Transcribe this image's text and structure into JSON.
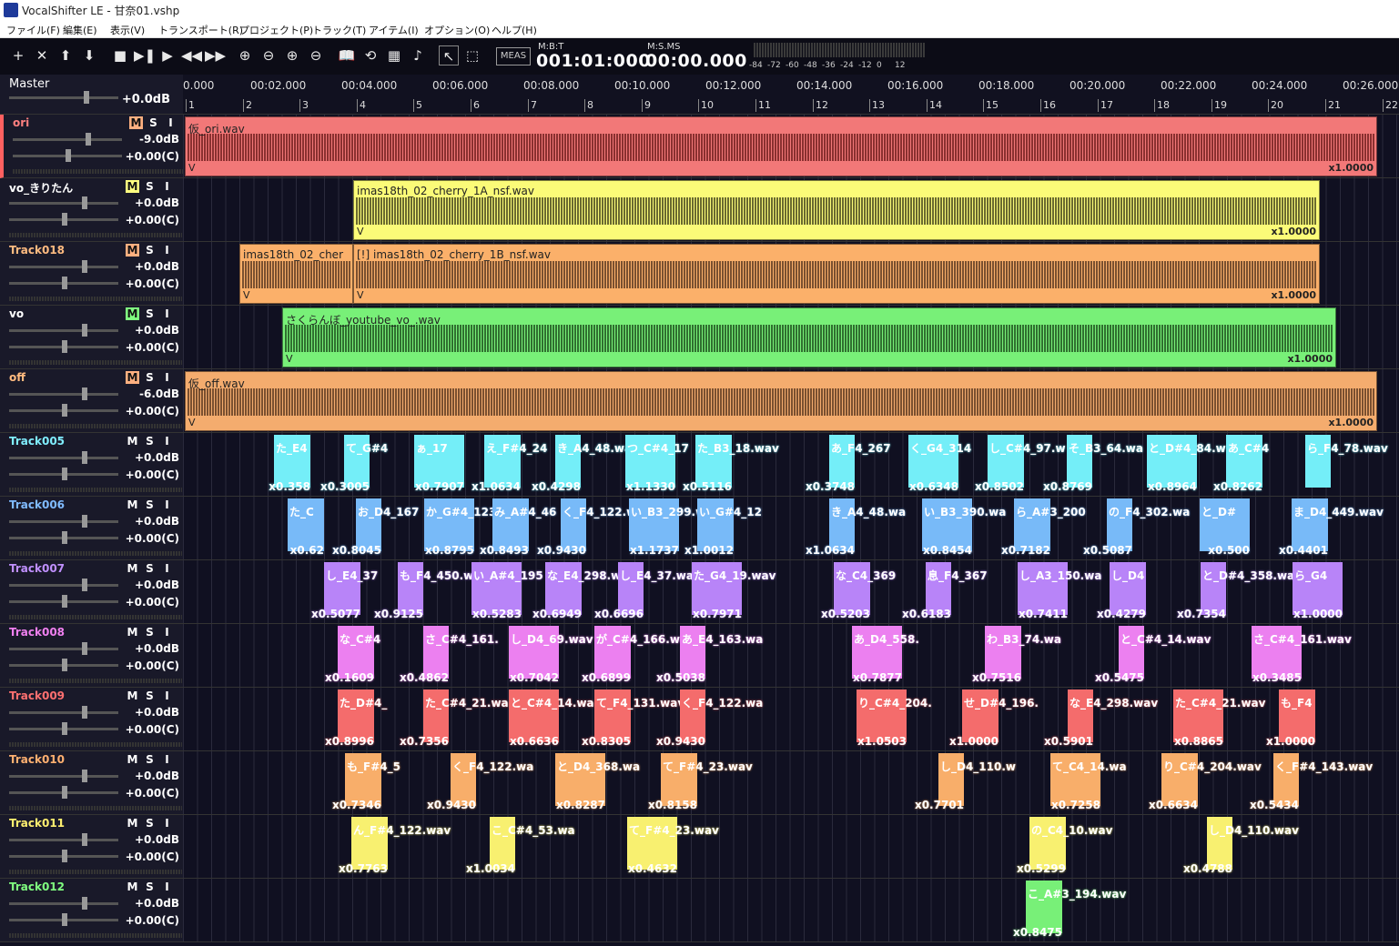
{
  "window": {
    "title": "VocalShifter LE - 甘奈01.vshp"
  },
  "menu": [
    "ファイル(F)",
    "編集(E)",
    "表示(V)",
    "トランスポート(R)",
    "プロジェクト(P)",
    "トラック(T)",
    "アイテム(I)",
    "オプション(O)",
    "ヘルプ(H)"
  ],
  "toolbar": {
    "icons": [
      "plus-icon",
      "close-icon",
      "arrow-up-icon",
      "arrow-down-icon",
      "stop-icon",
      "play-pause-icon",
      "play-icon",
      "rewind-icon",
      "fast-forward-icon",
      "zoom-in-h-icon",
      "zoom-out-h-icon",
      "zoom-in-v-icon",
      "zoom-out-v-icon",
      "book-icon",
      "loop-icon",
      "grid-icon",
      "note-icon",
      "pointer-icon",
      "select-rect-icon"
    ],
    "glyphs": [
      "+",
      "✕",
      "⬆",
      "⬇",
      "■",
      "▶❚",
      "▶",
      "◀◀",
      "▶▶",
      "⊕",
      "⊖",
      "⊕",
      "⊖",
      "📖",
      "⟲",
      "▦",
      "♪",
      "↖",
      "⬚"
    ],
    "meas_label": "MEAS",
    "mbt_label": "M:B:T",
    "mbt_value": "001:01:000",
    "msms_label": "M:S.MS",
    "msms_value": "00:00.000",
    "meter_ticks": [
      "-84",
      "-72",
      "-60",
      "-48",
      "-36",
      "-24",
      "-12",
      "0",
      "12"
    ]
  },
  "master": {
    "name": "Master",
    "volume": "+0.0dB"
  },
  "ruler": {
    "times": [
      "0.000",
      "00:02.000",
      "00:04.000",
      "00:06.000",
      "00:08.000",
      "00:10.000",
      "00:12.000",
      "00:14.000",
      "00:16.000",
      "00:18.000",
      "00:20.000",
      "00:22.000",
      "00:24.000",
      "00:26.000"
    ],
    "measures": [
      "1",
      "2",
      "3",
      "4",
      "5",
      "6",
      "7",
      "8",
      "9",
      "10",
      "11",
      "12",
      "13",
      "14",
      "15",
      "16",
      "17",
      "18",
      "19",
      "20",
      "21",
      "22"
    ]
  },
  "colors": {
    "ori": "#f27878",
    "vo_k": "#fbfb78",
    "t018": "#fbb06a",
    "vo": "#78f078",
    "off": "#f4ac6e",
    "t005": "#74eef8",
    "t006": "#78baf8",
    "t007": "#b884f8",
    "t008": "#ec80f0",
    "t009": "#f46c6c",
    "t010": "#f8ae6a",
    "t011": "#f8f070",
    "t012": "#78f078"
  },
  "tracks": [
    {
      "name": "ori",
      "volume": "-9.0dB",
      "pan": "+0.00(C)",
      "mute": true,
      "name_color": "#ff8080"
    },
    {
      "name": "vo_きりたん",
      "volume": "+0.0dB",
      "pan": "+0.00(C)",
      "mute": true,
      "name_color": "#ffffff"
    },
    {
      "name": "Track018",
      "volume": "+0.0dB",
      "pan": "+0.00(C)",
      "mute": true,
      "name_color": "#ffbb80"
    },
    {
      "name": "vo",
      "volume": "+0.0dB",
      "pan": "+0.00(C)",
      "mute": true,
      "name_color": "#ffffff"
    },
    {
      "name": "off",
      "volume": "-6.0dB",
      "pan": "+0.00(C)",
      "mute": true,
      "name_color": "#ffbb80"
    },
    {
      "name": "Track005",
      "volume": "+0.0dB",
      "pan": "+0.00(C)",
      "mute": false,
      "name_color": "#80eeff"
    },
    {
      "name": "Track006",
      "volume": "+0.0dB",
      "pan": "+0.00(C)",
      "mute": false,
      "name_color": "#80bbff"
    },
    {
      "name": "Track007",
      "volume": "+0.0dB",
      "pan": "+0.00(C)",
      "mute": false,
      "name_color": "#c090ff"
    },
    {
      "name": "Track008",
      "volume": "+0.0dB",
      "pan": "+0.00(C)",
      "mute": false,
      "name_color": "#f080f0"
    },
    {
      "name": "Track009",
      "volume": "+0.0dB",
      "pan": "+0.00(C)",
      "mute": false,
      "name_color": "#ff7070"
    },
    {
      "name": "Track010",
      "volume": "+0.0dB",
      "pan": "+0.00(C)",
      "mute": false,
      "name_color": "#ffb070"
    },
    {
      "name": "Track011",
      "volume": "+0.0dB",
      "pan": "+0.00(C)",
      "mute": false,
      "name_color": "#fff070"
    },
    {
      "name": "Track012",
      "volume": "+0.0dB",
      "pan": "+0.00(C)",
      "mute": false,
      "name_color": "#80ff80"
    }
  ],
  "msi": {
    "m": "M",
    "s": "S",
    "i": "I"
  },
  "lanes": [
    {
      "clips": [
        {
          "label": "仮_ori.wav",
          "v": "V",
          "scale": "x1.0000",
          "color": "ori",
          "wave": "#8a3030"
        }
      ]
    },
    {
      "clips": [
        {
          "label": "imas18th_02_cherry_1A_nsf.wav",
          "v": "V",
          "scale": "x1.0000",
          "color": "vo_k",
          "wave": "#6a6a30"
        }
      ]
    },
    {
      "clips": [
        {
          "label": "imas18th_02_cher",
          "v": "V",
          "scale": "",
          "color": "t018",
          "wave": "#7a5030"
        },
        {
          "label": "[!] imas18th_02_cherry_1B_nsf.wav",
          "v": "V",
          "scale": "x1.0000",
          "color": "t018",
          "wave": "#7a5030"
        }
      ]
    },
    {
      "clips": [
        {
          "label": "さくらんぼ_youtube_vo_.wav",
          "v": "V",
          "scale": "x1.0000",
          "color": "vo",
          "wave": "#307030"
        }
      ]
    },
    {
      "clips": [
        {
          "label": "仮_off.wav",
          "v": "V",
          "scale": "x1.0000",
          "color": "off",
          "wave": "#7a5030"
        }
      ]
    },
    {
      "color": "t005",
      "labels": [
        "た_E4",
        "て_G#4",
        "ぁ_17",
        "え_F#4_24",
        "き_A4_48.wa",
        "つ_C#4_17",
        "た_B3_18.wav",
        "あ_F4_267",
        "く_G4_314",
        "し_C#4_97.w",
        "そ_B3_64.wa",
        "と_D#4_84.w",
        "あ_C#4",
        "ら_F4_78.wav"
      ],
      "values": [
        "x0.358",
        "x0.3005",
        "x0.7907",
        "x1.0634",
        "x0.4298",
        "x1.1330",
        "x0.5116",
        "x0.3748",
        "x0.6348",
        "x0.8502",
        "x0.8769",
        "x0.8964",
        "x0.8262"
      ]
    },
    {
      "color": "t006",
      "labels": [
        "た_C",
        "お_D4_167",
        "か_G#4_123",
        "み_A#4_46",
        "く_F4_122.wa",
        "い_B3_299.wav",
        "い_G#4_12",
        "き_A4_48.wa",
        "い_B3_390.wa",
        "ら_A#3_200",
        "の_F4_302.wa",
        "と_D#",
        "ま_D4_449.wav"
      ],
      "values": [
        "x0.62",
        "x0.8045",
        "x0.8795",
        "x0.8493",
        "x0.9430",
        "x1.1737",
        "x1.0012",
        "x1.0634",
        "x0.8454",
        "x0.7182",
        "x0.5087",
        "x0.500",
        "x0.4401"
      ]
    },
    {
      "color": "t007",
      "labels": [
        "し_E4_37",
        "も_F4_450.wa",
        "い_A#4_195",
        "な_E4_298.wav",
        "し_E4_37.wa",
        "た_G4_19.wav",
        "な_C4_369",
        "息_F4_367",
        "し_A3_150.wa",
        "し_D4",
        "と_D#4_358.wav",
        "ら_G4"
      ],
      "values": [
        "x0.5077",
        "x0.9125",
        "x0.5283",
        "x0.6949",
        "x0.6696",
        "x0.7971",
        "x0.5203",
        "x0.6183",
        "x0.7411",
        "x0.4279",
        "x0.7354",
        "x1.0000"
      ]
    },
    {
      "color": "t008",
      "labels": [
        "な_C#4",
        "さ_C#4_161.",
        "し_D4_69.wav",
        "が_C#4_166.wav",
        "あ_E4_163.wa",
        "あ_D4_558.",
        "わ_B3_74.wa",
        "と_C#4_14.wav",
        "さ_C#4_161.wav"
      ],
      "values": [
        "x0.1609",
        "x0.4862",
        "x0.7042",
        "x0.6899",
        "x0.5038",
        "x0.7877",
        "x0.7516",
        "x0.5475",
        "x0.3485"
      ]
    },
    {
      "color": "t009",
      "labels": [
        "た_D#4_",
        "た_C#4_21.wa",
        "と_C#4_14.wa",
        "て_F4_131.wav",
        "く_F4_122.wa",
        "り_C#4_204.",
        "せ_D#4_196.",
        "な_E4_298.wav",
        "た_C#4_21.wav",
        "も_F4"
      ],
      "values": [
        "x0.8996",
        "x0.7356",
        "x0.6636",
        "x0.8305",
        "x0.9430",
        "x1.0503",
        "x1.0000",
        "x0.5901",
        "x0.8865",
        "x1.0000"
      ]
    },
    {
      "color": "t010",
      "labels": [
        "も_F#4_5",
        "く_F4_122.wa",
        "と_D4_368.wa",
        "て_F#4_23.wav",
        "し_D4_110.w",
        "て_C4_14.wa",
        "り_C#4_204.wav",
        "く_F#4_143.wav"
      ],
      "values": [
        "x0.7346",
        "x0.9430",
        "x0.8287",
        "x0.8158",
        "x0.7701",
        "x0.7258",
        "x0.6634",
        "x0.5434"
      ]
    },
    {
      "color": "t011",
      "labels": [
        "ん_F#4_122.wav",
        "こ_C#4_53.wa",
        "て_F#4_23.wav",
        "の_C4_10.wav",
        "し_D4_110.wav"
      ],
      "values": [
        "x0.7763",
        "x1.0034",
        "x0.4632",
        "x0.5299",
        "x0.4788"
      ]
    },
    {
      "color": "t012",
      "labels": [
        "こ_A#3_194.wav"
      ],
      "values": [
        "x0.8475"
      ]
    }
  ]
}
